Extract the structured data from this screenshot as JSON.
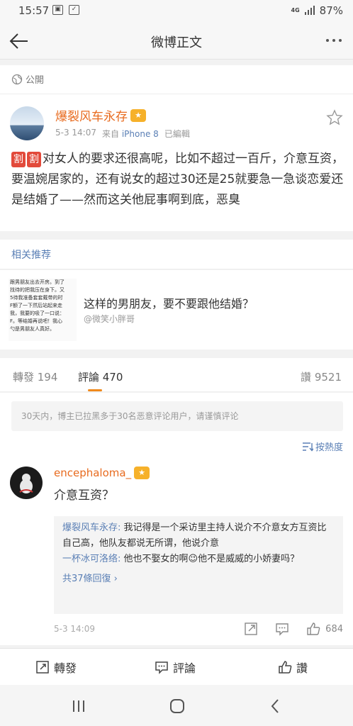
{
  "status": {
    "time": "15:57",
    "network": "4G",
    "battery": "87%"
  },
  "nav": {
    "title": "微博正文"
  },
  "post": {
    "visibility": "公開",
    "author": "爆裂风车永存",
    "date": "5-3 14:07",
    "source_prefix": "来自",
    "source_device": "iPhone 8",
    "edited": "已編輯",
    "tag1": "割",
    "tag2": "割",
    "text": "对女人的要求还很高呢，比如不超过一百斤，介意互资，要温婉居家的，还有说女的超过30还是25就要急一急谈恋爱还是结婚了——然而这关他屁事啊到底，恶臭"
  },
  "related": {
    "header": "相关推荐",
    "title": "这样的男朋友，要不要跟他结婚？",
    "user": "@微笑小胖哥",
    "thumb_lines": [
      "跟男朋友出去开房。到了",
      "找待的把我压在身下。又",
      "5待我准备套套戴带的时",
      "F额了一下然后站起来走",
      "我，我要的吸了一口说：",
      "F。等结婚再说吧！我心",
      "勺是男朋友人真好。"
    ]
  },
  "tabs": {
    "repost": "轉發 194",
    "comments": "評論 470",
    "likes": "讚 9521"
  },
  "notice": "30天内，博主已拉黑多于30名恶意评论用户，请谨慎评论",
  "sort_label": "按熱度",
  "comment": {
    "author": "encephaloma_",
    "text": "介意互资？",
    "time": "5-3 14:09",
    "like_count": "684",
    "replies": [
      {
        "name": "爆裂风车永存:",
        "text": " 我记得是一个采访里主持人说介不介意女方互资比自己高，他队友都说无所谓，他说介意"
      },
      {
        "name": "一杯冰可洛络:",
        "text": " 他也不娶女的啊😉他不是威威的小娇妻吗？"
      }
    ],
    "more_replies": "共37條回復 ›"
  },
  "actionbar": {
    "repost": "轉發",
    "comment": "評論",
    "like": "讚"
  },
  "colors": {
    "accent_orange": "#e86b1f",
    "link_blue": "#5a7fb5",
    "tab_underline": "#f08a1c"
  }
}
